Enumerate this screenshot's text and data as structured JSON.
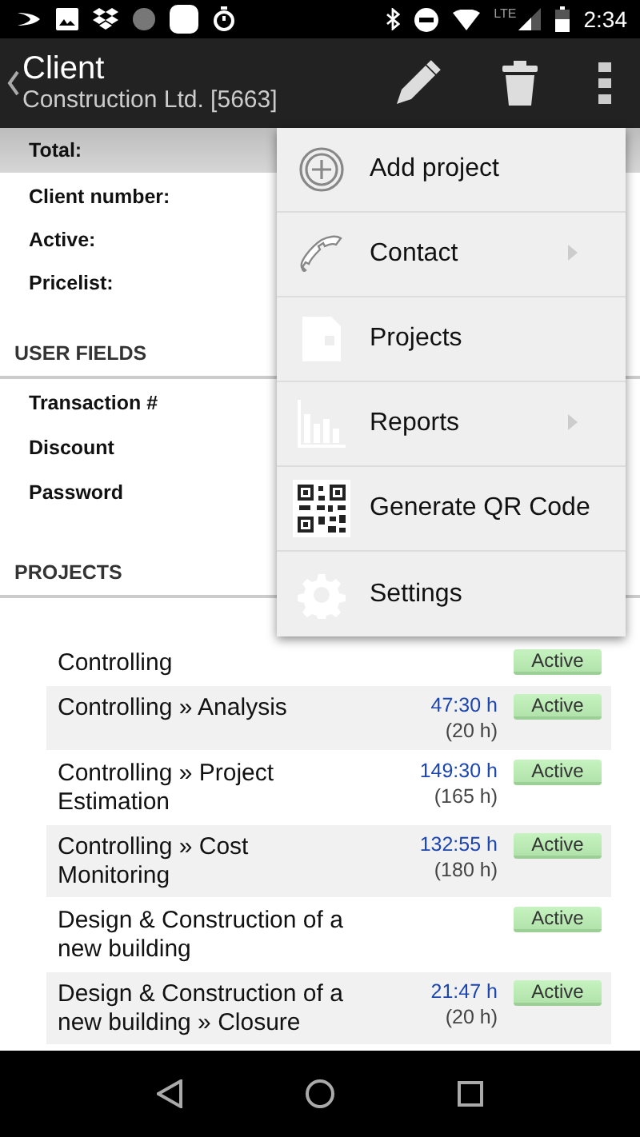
{
  "status_bar": {
    "time": "2:34",
    "network": "LTE"
  },
  "app_bar": {
    "title": "Client",
    "subtitle": "Construction Ltd. [5663]"
  },
  "summary": {
    "label": "Total:"
  },
  "fields": [
    {
      "label": "Client number:"
    },
    {
      "label": "Active:"
    },
    {
      "label": "Pricelist:"
    }
  ],
  "user_fields": {
    "heading": "USER FIELDS",
    "items": [
      {
        "label": "Transaction #"
      },
      {
        "label": "Discount"
      },
      {
        "label": "Password"
      }
    ]
  },
  "projects": {
    "heading": "PROJECTS",
    "rows": [
      {
        "name": "Controlling",
        "status": "Active"
      },
      {
        "name": "Controlling » Analysis",
        "hours": "47:30 h",
        "budget": "(20 h)",
        "status": "Active"
      },
      {
        "name": "Controlling » Project Estimation",
        "hours": "149:30 h",
        "budget": "(165 h)",
        "status": "Active"
      },
      {
        "name": "Controlling » Cost Monitoring",
        "hours": "132:55 h",
        "budget": "(180 h)",
        "status": "Active"
      },
      {
        "name": "Design & Construction of a new building",
        "status": "Active"
      },
      {
        "name": "Design & Construction of a new building » Closure",
        "hours": "21:47 h",
        "budget": "(20 h)",
        "status": "Active"
      }
    ]
  },
  "menu": {
    "items": [
      {
        "kind": "add",
        "label": "Add project",
        "submenu": false
      },
      {
        "kind": "phone",
        "label": "Contact",
        "submenu": true
      },
      {
        "kind": "document",
        "label": "Projects",
        "submenu": false
      },
      {
        "kind": "chart",
        "label": "Reports",
        "submenu": true
      },
      {
        "kind": "qr",
        "label": "Generate QR Code",
        "submenu": false
      },
      {
        "kind": "gear",
        "label": "Settings",
        "submenu": false
      }
    ]
  }
}
